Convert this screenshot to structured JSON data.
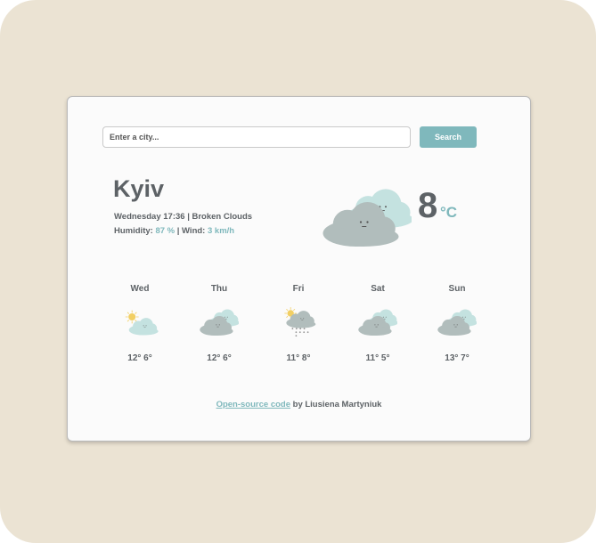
{
  "search": {
    "placeholder": "Enter a city...",
    "button_label": "Search"
  },
  "current": {
    "city": "Kyiv",
    "datetime": "Wednesday 17:36",
    "description": "Broken Clouds",
    "humidity_label": "Humidity:",
    "humidity": "87 %",
    "wind_label": "Wind:",
    "wind": "3 km/h",
    "temperature": "8",
    "unit": "°C",
    "icon": "broken-clouds"
  },
  "forecast": [
    {
      "day": "Wed",
      "max": "12°",
      "min": "6°",
      "icon": "sun-cloud"
    },
    {
      "day": "Thu",
      "max": "12°",
      "min": "6°",
      "icon": "broken-clouds"
    },
    {
      "day": "Fri",
      "max": "11°",
      "min": "8°",
      "icon": "sun-rain"
    },
    {
      "day": "Sat",
      "max": "11°",
      "min": "5°",
      "icon": "broken-clouds"
    },
    {
      "day": "Sun",
      "max": "13°",
      "min": "7°",
      "icon": "broken-clouds"
    }
  ],
  "footer": {
    "link_text": "Open-source code",
    "text": "by Liusiena Martyniuk"
  },
  "colors": {
    "accent": "#7fb8bc",
    "text": "#5d6266",
    "background": "#ebe3d3"
  }
}
